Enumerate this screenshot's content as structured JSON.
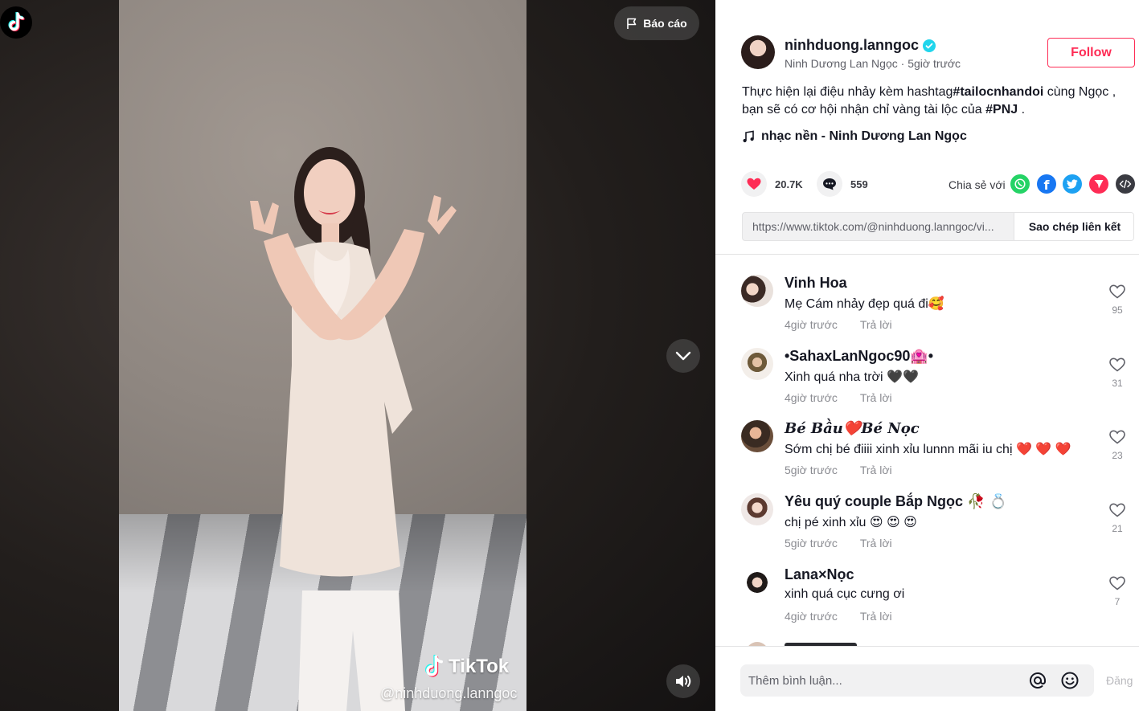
{
  "video": {
    "report_label": "Báo cáo",
    "watermark_brand": "TikTok",
    "watermark_user": "@ninhduong.lanngoc"
  },
  "author": {
    "username": "ninhduong.lanngoc",
    "display_name": "Ninh Dương Lan Ngọc",
    "time": "5giờ trước",
    "follow_label": "Follow"
  },
  "description": {
    "part1": "Thực hiện lại điệu nhảy kèm hashtag",
    "hashtag1": "#tailocnhandoi",
    "part2": " cùng Ngọc , bạn sẽ có cơ hội nhận chỉ vàng tài lộc của ",
    "hashtag2": "#PNJ",
    "part3": " ."
  },
  "music": "nhạc nền - Ninh Dương Lan Ngọc",
  "stats": {
    "likes": "20.7K",
    "comments": "559",
    "share_label": "Chia sẻ với"
  },
  "link": {
    "url": "https://www.tiktok.com/@ninhduong.lanngoc/vi...",
    "copy_label": "Sao chép liên kết"
  },
  "comments": [
    {
      "name": "Vinh Hoa",
      "text": "Mẹ Cám nhảy đẹp quá đi🥰",
      "time": "4giờ trước",
      "reply": "Trả lời",
      "likes": "95"
    },
    {
      "name": "•SahaxLanNgoc90🏩•",
      "text": "Xinh quá nha trời 🖤🖤",
      "time": "4giờ trước",
      "reply": "Trả lời",
      "likes": "31"
    },
    {
      "name": "𝑩𝒆́ 𝑩𝒂̂̀𝒖❤️𝑩𝒆́ 𝑵𝒐̣𝒄",
      "text": "Sớm chị bé điiii xinh xỉu lunnn mãi iu chị ❤️ ❤️ ❤️",
      "time": "5giờ trước",
      "reply": "Trả lời",
      "likes": "23"
    },
    {
      "name": "Yêu quý couple Bắp Ngọc 🥀 💍",
      "text": "chị pé xinh xỉu 😍 😍 😍",
      "time": "5giờ trước",
      "reply": "Trả lời",
      "likes": "21"
    },
    {
      "name": "Lana×Nọc",
      "text": "xinh quá cục cưng ơi",
      "time": "4giờ trước",
      "reply": "Trả lời",
      "likes": "7"
    }
  ],
  "composer": {
    "placeholder": "Thêm bình luận...",
    "post_label": "Đăng"
  },
  "colors": {
    "accent": "#fe2c55",
    "verified": "#20d5ec",
    "whatsapp": "#25d366",
    "facebook": "#1877f2",
    "twitter": "#1da1f2",
    "telegram": "#fe2c55"
  }
}
